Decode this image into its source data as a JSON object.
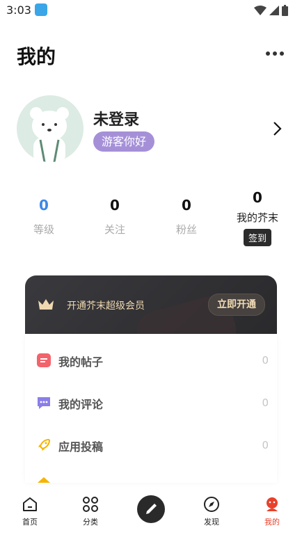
{
  "status_bar": {
    "time": "3:03"
  },
  "header": {
    "title": "我的"
  },
  "profile": {
    "username": "未登录",
    "greeting": "游客你好"
  },
  "stats": [
    {
      "value": "0",
      "label": "等级"
    },
    {
      "value": "0",
      "label": "关注"
    },
    {
      "value": "0",
      "label": "粉丝"
    },
    {
      "value": "0",
      "label": "我的芥末",
      "action": "签到"
    }
  ],
  "vip": {
    "text": "开通芥末超级会员",
    "button": "立即开通"
  },
  "menu": [
    {
      "label": "我的帖子",
      "count": "0",
      "icon": "post-icon"
    },
    {
      "label": "我的评论",
      "count": "0",
      "icon": "comment-icon"
    },
    {
      "label": "应用投稿",
      "count": "0",
      "icon": "rocket-icon"
    }
  ],
  "nav": [
    {
      "label": "首页",
      "icon": "home-icon"
    },
    {
      "label": "分类",
      "icon": "grid-icon"
    },
    {
      "label": "",
      "icon": "pen-icon"
    },
    {
      "label": "发现",
      "icon": "compass-icon"
    },
    {
      "label": "我的",
      "icon": "profile-icon",
      "active": true
    }
  ],
  "colors": {
    "accent": "#e8412c",
    "stat_blue": "#3e88e6",
    "badge_purple": "#a590d8"
  }
}
